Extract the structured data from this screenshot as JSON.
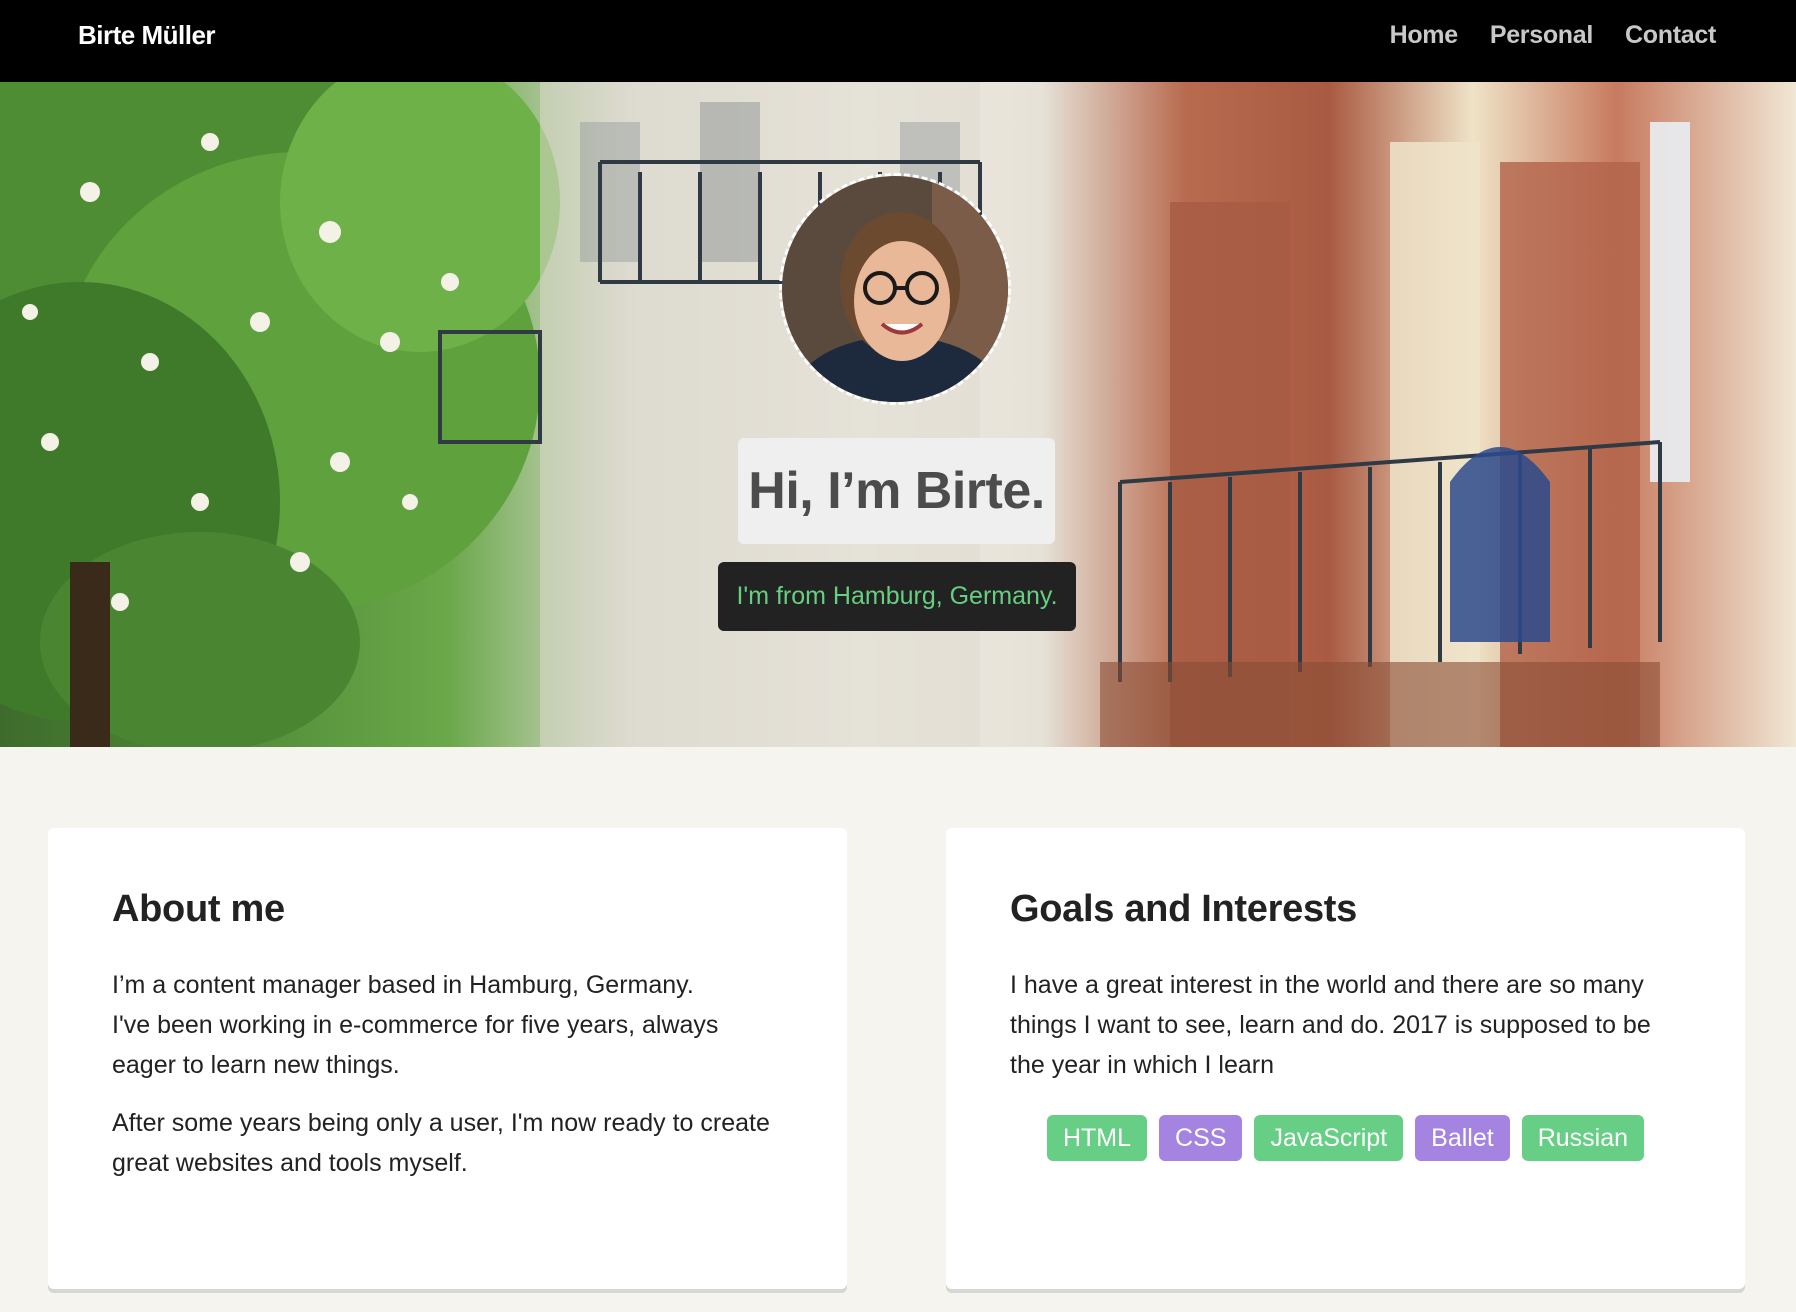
{
  "nav": {
    "brand": "Birte Müller",
    "links": [
      "Home",
      "Personal",
      "Contact"
    ]
  },
  "hero": {
    "title": "Hi, I’m Birte.",
    "subtitle": "I'm from Hamburg, Germany."
  },
  "about": {
    "heading": "About me",
    "line1": "I’m a content manager based in Hamburg, Germany.",
    "line2": "I've been working in e-commerce for five years, always eager to learn new things.",
    "paragraph2": "After some years being only a user, I'm now ready to create great websites and tools myself."
  },
  "goals": {
    "heading": "Goals and Interests",
    "text": "I have a great interest in the world and there are so many things I want to see, learn and do. 2017 is supposed to be the year in which I learn",
    "tags": [
      {
        "label": "HTML",
        "color": "#66cf85"
      },
      {
        "label": "CSS",
        "color": "#a583e0"
      },
      {
        "label": "JavaScript",
        "color": "#66cf85"
      },
      {
        "label": "Ballet",
        "color": "#a583e0"
      },
      {
        "label": "Russian",
        "color": "#66cf85"
      }
    ]
  }
}
